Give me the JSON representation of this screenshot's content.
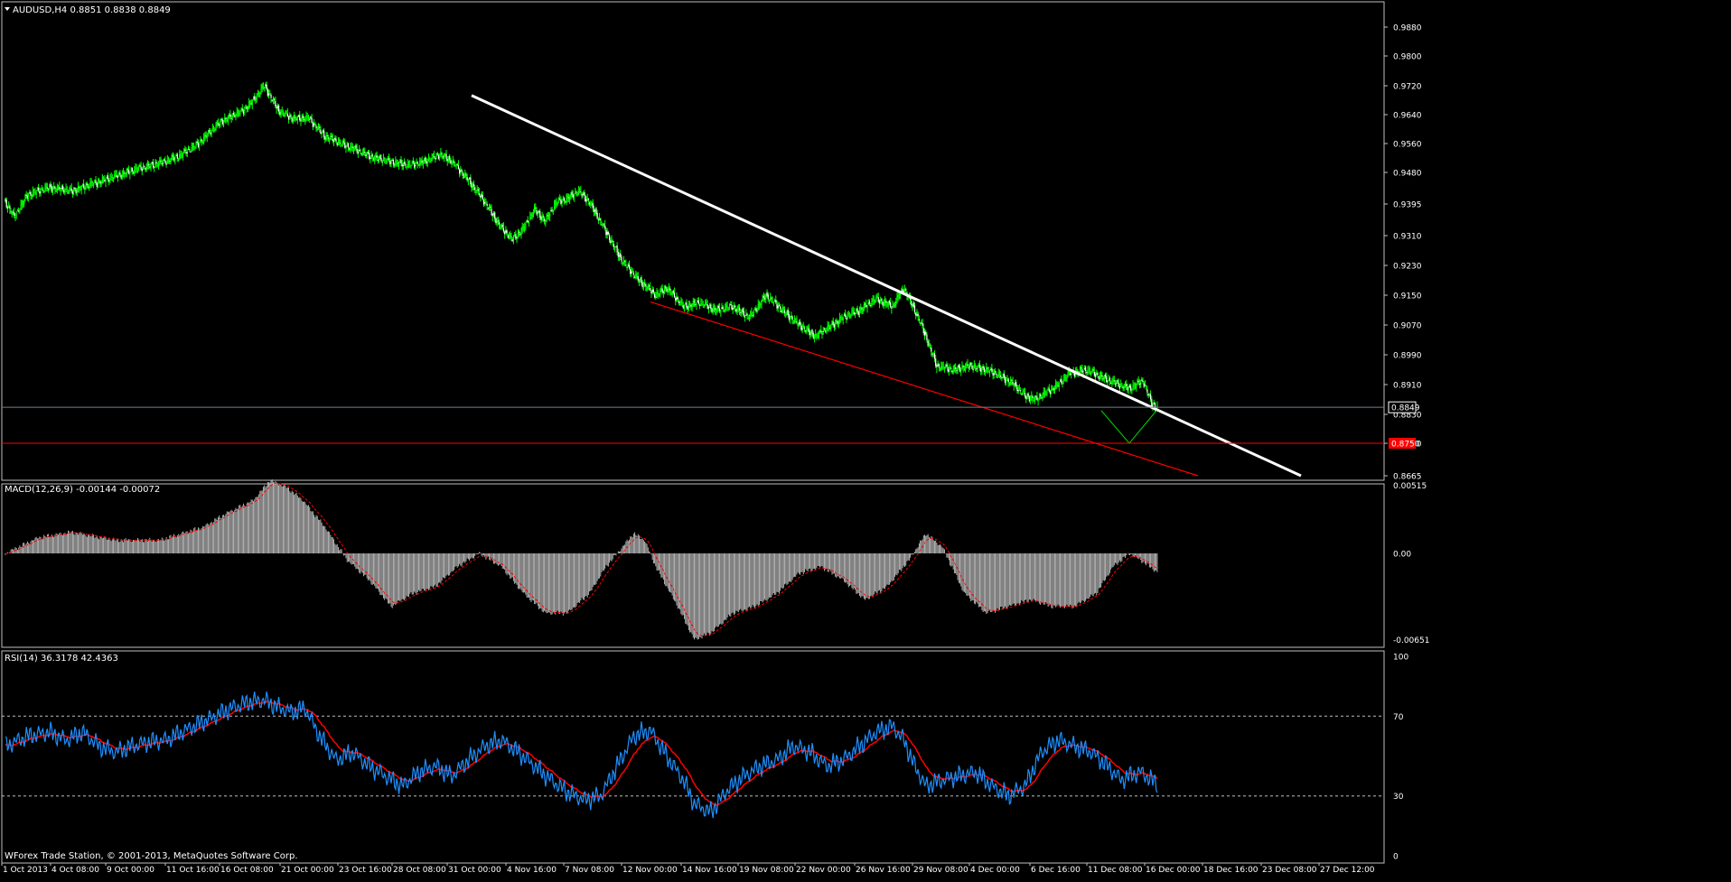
{
  "colors": {
    "background": "#000000",
    "frame": "#c0c0c0",
    "bull_candle": "#00ff00",
    "bear_candle": "#ffffff",
    "trend_white": "#ffffff",
    "trend_red": "#ff0000",
    "bid_line": "#708090",
    "support_line": "#ff0000",
    "projection": "#00c000",
    "macd_hist": "#c0c0c0",
    "signal": "#ff0000",
    "rsi": "#1e90ff",
    "rsi_ma": "#ff0000",
    "label_bg_red": "#ff0000"
  },
  "main_panel": {
    "header": "AUDUSD,H4  0.8851 0.8838 0.8849",
    "header_icon": "triangle-down-icon",
    "price_ticks": [
      "0.9880",
      "0.9800",
      "0.9720",
      "0.9640",
      "0.9560",
      "0.9480",
      "0.9395",
      "0.9310",
      "0.9230",
      "0.9150",
      "0.9070",
      "0.8990",
      "0.8910",
      "0.8830",
      "0.8750",
      "0.8665"
    ],
    "current_price_label": "0.8849",
    "support_label": "0.8750",
    "footer": "WForex Trade Station, © 2001-2013, MetaQuotes Software Corp."
  },
  "macd_panel": {
    "header": "MACD(12,26,9) -0.00144 -0.00072",
    "ticks": [
      "0.00515",
      "0.00",
      "-0.00651"
    ]
  },
  "rsi_panel": {
    "header": "RSI(14) 36.3178 42.4363",
    "ticks": [
      "100",
      "70",
      "30",
      "0"
    ]
  },
  "time_axis": {
    "labels": [
      "1 Oct 2013",
      "4 Oct 08:00",
      "9 Oct 00:00",
      "11 Oct 16:00",
      "16 Oct 08:00",
      "21 Oct 00:00",
      "23 Oct 16:00",
      "28 Oct 08:00",
      "31 Oct 00:00",
      "4 Nov 16:00",
      "7 Nov 08:00",
      "12 Nov 00:00",
      "14 Nov 16:00",
      "19 Nov 08:00",
      "22 Nov 00:00",
      "26 Nov 16:00",
      "29 Nov 08:00",
      "4 Dec 00:00",
      "6 Dec 16:00",
      "11 Dec 08:00",
      "16 Dec 00:00",
      "18 Dec 16:00",
      "23 Dec 08:00",
      "27 Dec 12:00"
    ]
  },
  "chart_data": {
    "type": "candlestick",
    "symbol": "AUDUSD",
    "timeframe": "H4",
    "ylim": [
      0.8665,
      0.988
    ],
    "current_price": 0.8849,
    "support_level": 0.875,
    "price_path": [
      [
        0,
        0.94
      ],
      [
        8,
        0.936
      ],
      [
        20,
        0.942
      ],
      [
        40,
        0.944
      ],
      [
        60,
        0.943
      ],
      [
        80,
        0.945
      ],
      [
        100,
        0.947
      ],
      [
        120,
        0.949
      ],
      [
        145,
        0.951
      ],
      [
        160,
        0.953
      ],
      [
        175,
        0.956
      ],
      [
        195,
        0.962
      ],
      [
        215,
        0.965
      ],
      [
        225,
        0.968
      ],
      [
        235,
        0.972
      ],
      [
        248,
        0.965
      ],
      [
        260,
        0.963
      ],
      [
        275,
        0.963
      ],
      [
        290,
        0.958
      ],
      [
        305,
        0.956
      ],
      [
        320,
        0.954
      ],
      [
        335,
        0.952
      ],
      [
        350,
        0.951
      ],
      [
        365,
        0.95
      ],
      [
        380,
        0.951
      ],
      [
        395,
        0.953
      ],
      [
        405,
        0.951
      ],
      [
        420,
        0.946
      ],
      [
        435,
        0.94
      ],
      [
        450,
        0.933
      ],
      [
        460,
        0.93
      ],
      [
        470,
        0.933
      ],
      [
        480,
        0.938
      ],
      [
        490,
        0.935
      ],
      [
        500,
        0.94
      ],
      [
        510,
        0.941
      ],
      [
        520,
        0.943
      ],
      [
        530,
        0.94
      ],
      [
        545,
        0.932
      ],
      [
        560,
        0.924
      ],
      [
        575,
        0.919
      ],
      [
        590,
        0.915
      ],
      [
        600,
        0.917
      ],
      [
        615,
        0.912
      ],
      [
        630,
        0.913
      ],
      [
        645,
        0.911
      ],
      [
        660,
        0.912
      ],
      [
        675,
        0.909
      ],
      [
        690,
        0.915
      ],
      [
        705,
        0.911
      ],
      [
        720,
        0.907
      ],
      [
        735,
        0.904
      ],
      [
        745,
        0.906
      ],
      [
        760,
        0.909
      ],
      [
        775,
        0.911
      ],
      [
        790,
        0.914
      ],
      [
        805,
        0.912
      ],
      [
        815,
        0.917
      ],
      [
        825,
        0.911
      ],
      [
        835,
        0.904
      ],
      [
        845,
        0.896
      ],
      [
        860,
        0.895
      ],
      [
        875,
        0.896
      ],
      [
        890,
        0.895
      ],
      [
        905,
        0.893
      ],
      [
        915,
        0.891
      ],
      [
        925,
        0.888
      ],
      [
        935,
        0.887
      ],
      [
        945,
        0.889
      ],
      [
        955,
        0.891
      ],
      [
        965,
        0.894
      ],
      [
        980,
        0.895
      ],
      [
        995,
        0.893
      ],
      [
        1010,
        0.891
      ],
      [
        1020,
        0.89
      ],
      [
        1032,
        0.892
      ],
      [
        1040,
        0.886
      ],
      [
        1045,
        0.8849
      ]
    ],
    "trendlines": [
      {
        "name": "resistance",
        "color": "white",
        "from": [
          522,
          0.9693
        ],
        "to": [
          1440,
          0.8665
        ]
      },
      {
        "name": "support",
        "color": "red",
        "from": [
          720,
          0.9132
        ],
        "to": [
          1326,
          0.8665
        ]
      }
    ],
    "projection": [
      [
        1219,
        0.884
      ],
      [
        1250,
        0.875
      ],
      [
        1280,
        0.884
      ]
    ],
    "macd": {
      "current": -0.00144,
      "signal": -0.00072,
      "ylim": [
        -0.00651,
        0.00515
      ],
      "path": [
        [
          0,
          0.0
        ],
        [
          30,
          0.0012
        ],
        [
          60,
          0.0016
        ],
        [
          100,
          0.001
        ],
        [
          140,
          0.001
        ],
        [
          180,
          0.002
        ],
        [
          200,
          0.003
        ],
        [
          225,
          0.004
        ],
        [
          240,
          0.0055
        ],
        [
          255,
          0.005
        ],
        [
          270,
          0.004
        ],
        [
          290,
          0.002
        ],
        [
          310,
          -0.0005
        ],
        [
          330,
          -0.002
        ],
        [
          350,
          -0.004
        ],
        [
          370,
          -0.003
        ],
        [
          390,
          -0.0025
        ],
        [
          410,
          -0.001
        ],
        [
          430,
          0.0
        ],
        [
          450,
          -0.001
        ],
        [
          470,
          -0.003
        ],
        [
          490,
          -0.0045
        ],
        [
          510,
          -0.0045
        ],
        [
          530,
          -0.003
        ],
        [
          545,
          -0.001
        ],
        [
          560,
          0.0005
        ],
        [
          570,
          0.0015
        ],
        [
          580,
          0.001
        ],
        [
          590,
          -0.001
        ],
        [
          610,
          -0.004
        ],
        [
          625,
          -0.0065
        ],
        [
          640,
          -0.006
        ],
        [
          660,
          -0.0045
        ],
        [
          680,
          -0.004
        ],
        [
          700,
          -0.003
        ],
        [
          720,
          -0.0015
        ],
        [
          740,
          -0.001
        ],
        [
          760,
          -0.002
        ],
        [
          780,
          -0.0035
        ],
        [
          800,
          -0.0025
        ],
        [
          820,
          -0.0005
        ],
        [
          835,
          0.0015
        ],
        [
          850,
          0.0005
        ],
        [
          870,
          -0.003
        ],
        [
          890,
          -0.0045
        ],
        [
          910,
          -0.004
        ],
        [
          930,
          -0.0035
        ],
        [
          950,
          -0.004
        ],
        [
          970,
          -0.004
        ],
        [
          990,
          -0.003
        ],
        [
          1005,
          -0.001
        ],
        [
          1020,
          0.0
        ],
        [
          1030,
          -0.0005
        ],
        [
          1045,
          -0.0014
        ]
      ]
    },
    "rsi": {
      "current": 36.3178,
      "ma": 42.4363,
      "levels": [
        70,
        30
      ],
      "ylim": [
        0,
        100
      ],
      "path": [
        [
          0,
          55
        ],
        [
          20,
          60
        ],
        [
          40,
          62
        ],
        [
          55,
          58
        ],
        [
          70,
          62
        ],
        [
          85,
          55
        ],
        [
          100,
          52
        ],
        [
          115,
          55
        ],
        [
          130,
          57
        ],
        [
          145,
          58
        ],
        [
          160,
          62
        ],
        [
          175,
          66
        ],
        [
          190,
          70
        ],
        [
          205,
          74
        ],
        [
          220,
          77
        ],
        [
          235,
          78
        ],
        [
          245,
          75
        ],
        [
          260,
          72
        ],
        [
          272,
          74
        ],
        [
          285,
          60
        ],
        [
          300,
          48
        ],
        [
          315,
          52
        ],
        [
          330,
          45
        ],
        [
          345,
          40
        ],
        [
          360,
          35
        ],
        [
          375,
          42
        ],
        [
          390,
          45
        ],
        [
          405,
          40
        ],
        [
          420,
          48
        ],
        [
          435,
          55
        ],
        [
          450,
          58
        ],
        [
          465,
          52
        ],
        [
          480,
          45
        ],
        [
          495,
          38
        ],
        [
          510,
          32
        ],
        [
          525,
          28
        ],
        [
          540,
          30
        ],
        [
          555,
          45
        ],
        [
          570,
          60
        ],
        [
          585,
          63
        ],
        [
          600,
          50
        ],
        [
          615,
          38
        ],
        [
          625,
          26
        ],
        [
          640,
          22
        ],
        [
          655,
          33
        ],
        [
          670,
          40
        ],
        [
          685,
          45
        ],
        [
          700,
          48
        ],
        [
          715,
          55
        ],
        [
          730,
          52
        ],
        [
          745,
          45
        ],
        [
          760,
          48
        ],
        [
          775,
          55
        ],
        [
          790,
          62
        ],
        [
          805,
          65
        ],
        [
          815,
          58
        ],
        [
          825,
          45
        ],
        [
          835,
          35
        ],
        [
          850,
          38
        ],
        [
          865,
          40
        ],
        [
          880,
          42
        ],
        [
          895,
          35
        ],
        [
          910,
          30
        ],
        [
          925,
          35
        ],
        [
          940,
          52
        ],
        [
          955,
          58
        ],
        [
          970,
          55
        ],
        [
          985,
          52
        ],
        [
          1000,
          45
        ],
        [
          1012,
          38
        ],
        [
          1020,
          40
        ],
        [
          1030,
          42
        ],
        [
          1045,
          36
        ]
      ]
    }
  }
}
